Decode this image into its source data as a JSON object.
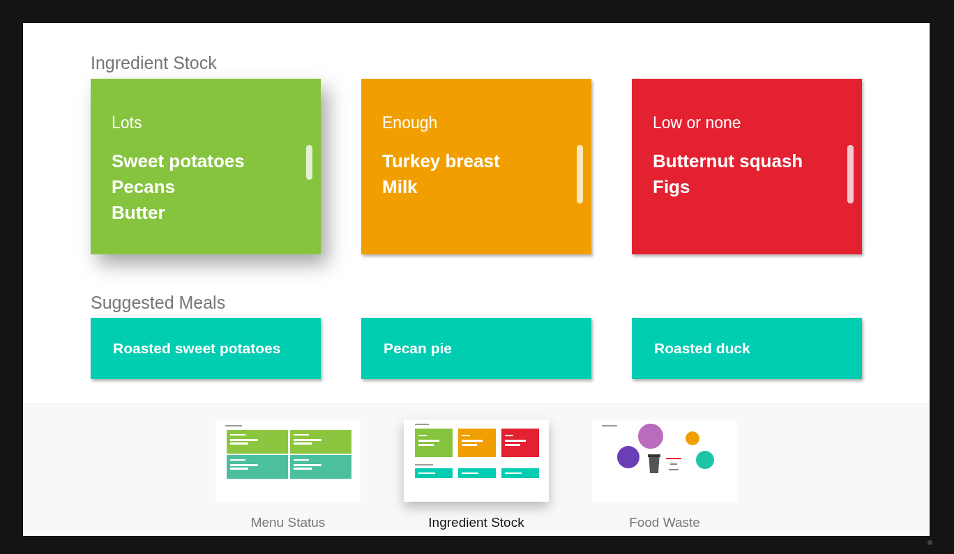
{
  "stock": {
    "title": "Ingredient Stock",
    "cards": [
      {
        "label": "Lots",
        "items": [
          "Sweet potatoes",
          "Pecans",
          "Butter"
        ],
        "color": "#86c440",
        "selected": true
      },
      {
        "label": "Enough",
        "items": [
          "Turkey breast",
          "Milk"
        ],
        "color": "#f19f00",
        "selected": false
      },
      {
        "label": "Low or none",
        "items": [
          "Butternut squash",
          "Figs"
        ],
        "color": "#e42131",
        "selected": false
      }
    ]
  },
  "meals": {
    "title": "Suggested Meals",
    "items": [
      {
        "label": "Roasted sweet potatoes"
      },
      {
        "label": "Pecan pie"
      },
      {
        "label": "Roasted duck"
      }
    ]
  },
  "screens": [
    {
      "kind": "menu",
      "label": "Menu Status",
      "selected": false,
      "preview": {
        "cards": [
          {
            "color": "#8cc63f"
          },
          {
            "color": "#8cc63f"
          },
          {
            "color": "#4cbf9f"
          },
          {
            "color": "#4cbf9f"
          }
        ]
      }
    },
    {
      "kind": "ingredients",
      "label": "Ingredient Stock",
      "selected": true,
      "preview": {
        "stock": [
          {
            "color": "#86c440"
          },
          {
            "color": "#f19f00"
          },
          {
            "color": "#e42131"
          }
        ],
        "meals": [
          {
            "color": "#00cdb1"
          },
          {
            "color": "#00cdb1"
          },
          {
            "color": "#00cdb1"
          }
        ]
      }
    },
    {
      "kind": "waste",
      "label": "Food Waste",
      "selected": false,
      "preview": {
        "bubbles": [
          {
            "color": "#b96cbd"
          },
          {
            "color": "#f19f00"
          },
          {
            "color": "#6a3fb5"
          },
          {
            "color": "#1cc5a5"
          }
        ]
      }
    }
  ]
}
